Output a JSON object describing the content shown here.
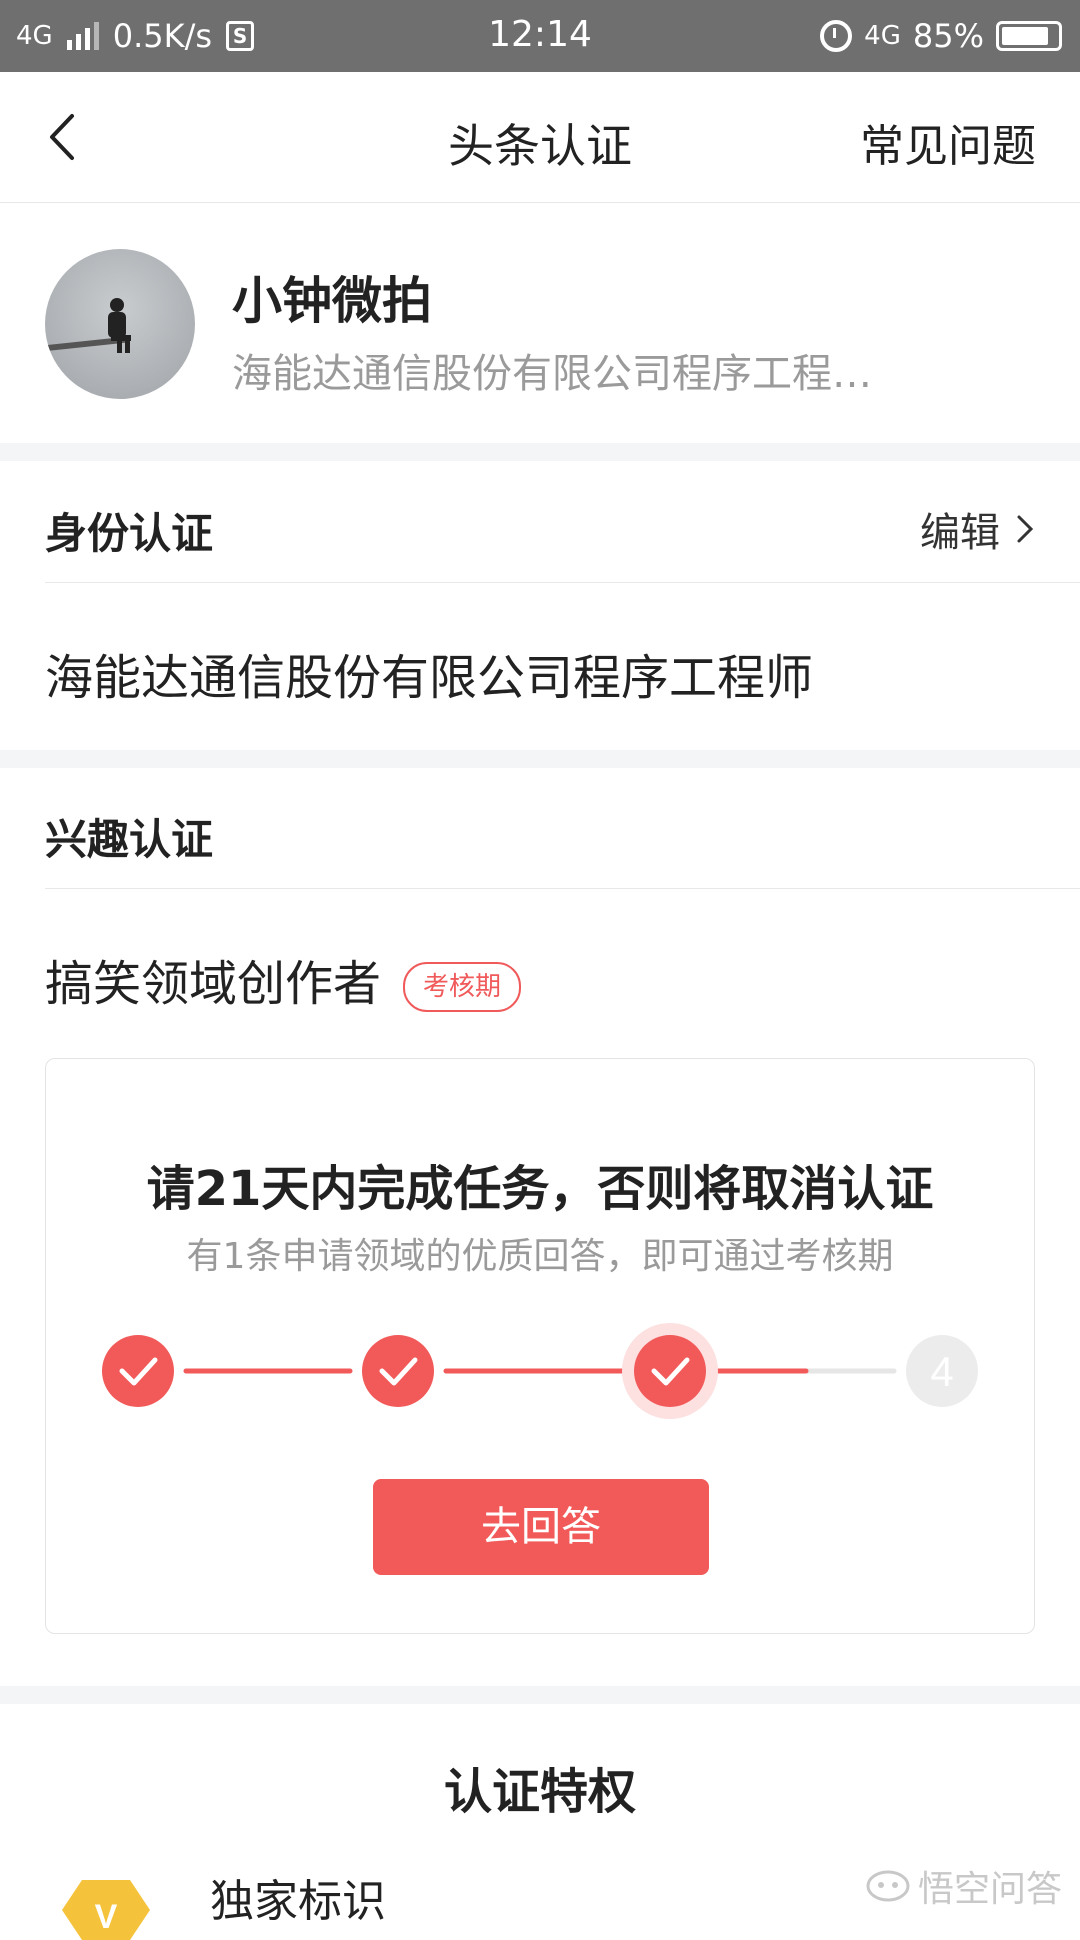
{
  "status_bar": {
    "network": "4G",
    "speed": "0.5K/s",
    "speed_icon": "S",
    "time": "12:14",
    "network_right": "4G",
    "battery_percent": "85%",
    "battery_level": 0.85
  },
  "nav": {
    "title": "头条认证",
    "faq_label": "常见问题"
  },
  "profile": {
    "name": "小钟微拍",
    "description": "海能达通信股份有限公司程序工程…"
  },
  "identity": {
    "title": "身份认证",
    "edit_label": "编辑",
    "value": "海能达通信股份有限公司程序工程师"
  },
  "interest": {
    "title": "兴趣认证",
    "field": "搞笑领域创作者",
    "tag": "考核期"
  },
  "task_card": {
    "title": "请21天内完成任务，否则将取消认证",
    "subtitle": "有1条申请领域的优质回答，即可通过考核期",
    "steps": [
      {
        "state": "done"
      },
      {
        "state": "done"
      },
      {
        "state": "current"
      },
      {
        "state": "pending",
        "label": "4"
      }
    ],
    "third_connector_progress": 0.5,
    "button_label": "去回答"
  },
  "privileges": {
    "title": "认证特权",
    "first_item": "独家标识"
  },
  "watermark": "悟空问答",
  "colors": {
    "accent": "#f25a5a",
    "status_bar": "#6f6f6f",
    "divider": "#f4f5f6"
  }
}
